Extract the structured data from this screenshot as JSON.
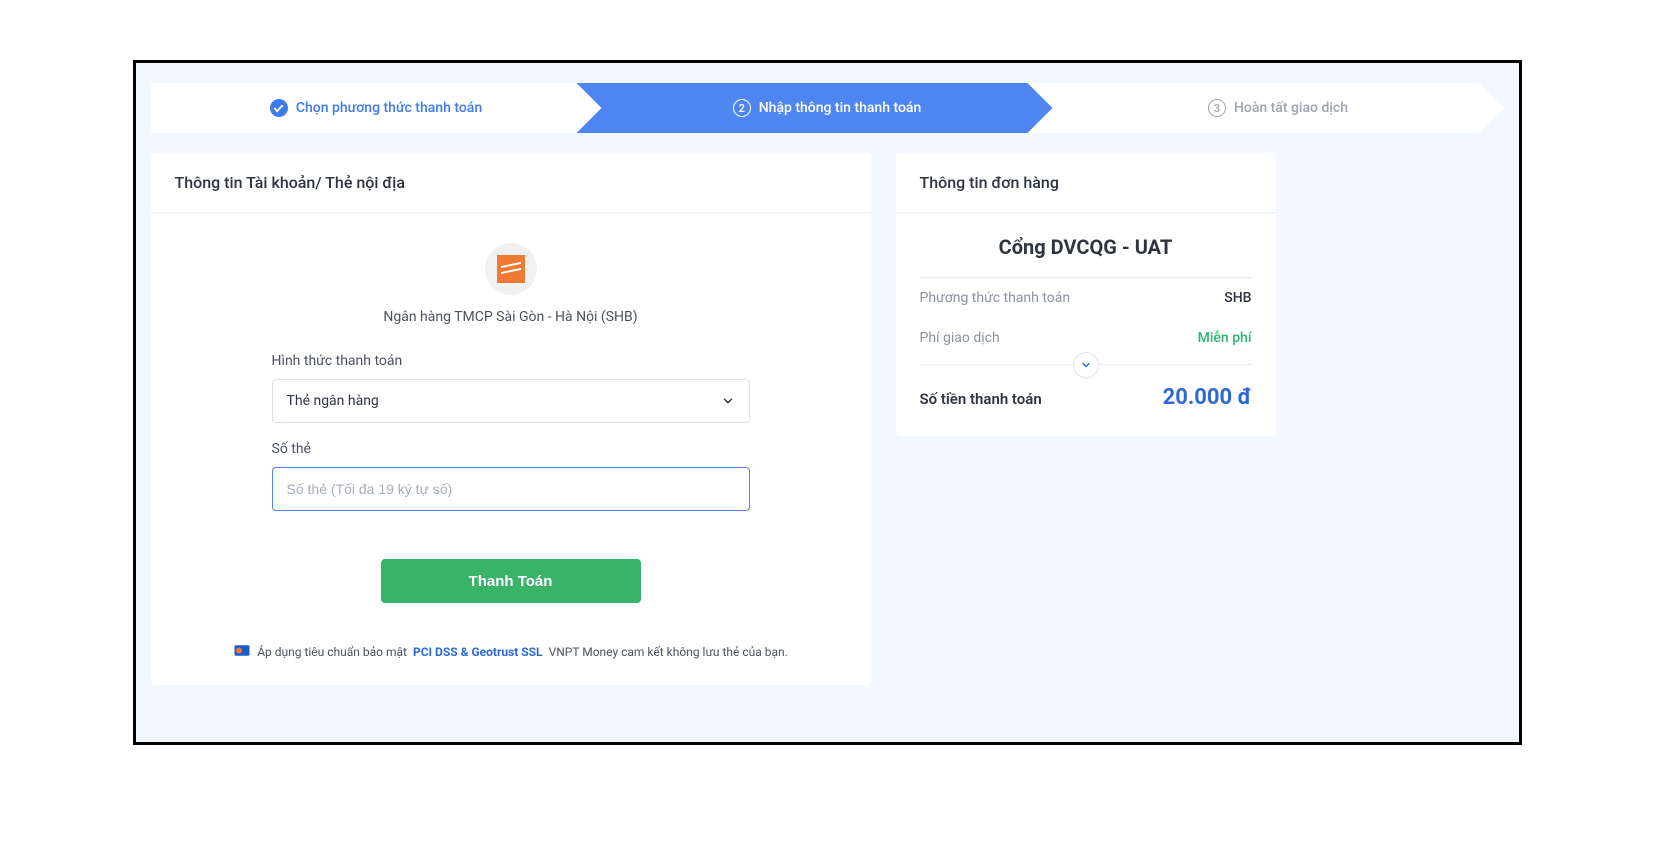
{
  "stepper": {
    "step1": {
      "label": "Chọn phương thức thanh toán"
    },
    "step2": {
      "num": "2",
      "label": "Nhập thông tin thanh toán"
    },
    "step3": {
      "num": "3",
      "label": "Hoàn tất giao dịch"
    }
  },
  "left": {
    "title": "Thông tin Tài khoản/ Thẻ nội địa",
    "bank_name": "Ngân hàng TMCP Sài Gòn - Hà Nội (SHB)",
    "form": {
      "method_label": "Hình thức thanh toán",
      "method_value": "Thẻ ngân hàng",
      "cardnum_label": "Số thẻ",
      "cardnum_placeholder": "Số thẻ (Tối đa 19 ký tự số)"
    },
    "submit_label": "Thanh Toán",
    "security": {
      "pre": "Áp dụng tiêu chuẩn bảo mật",
      "pci": "PCI DSS & Geotrust SSL",
      "post": "VNPT Money cam kết không lưu thẻ của bạn."
    }
  },
  "right": {
    "title": "Thông tin đơn hàng",
    "merchant": "Cổng DVCQG - UAT",
    "method_k": "Phương thức thanh toán",
    "method_v": "SHB",
    "fee_k": "Phí giao dịch",
    "fee_v": "Miễn phí",
    "total_k": "Số tiền thanh toán",
    "total_v": "20.000 đ"
  }
}
